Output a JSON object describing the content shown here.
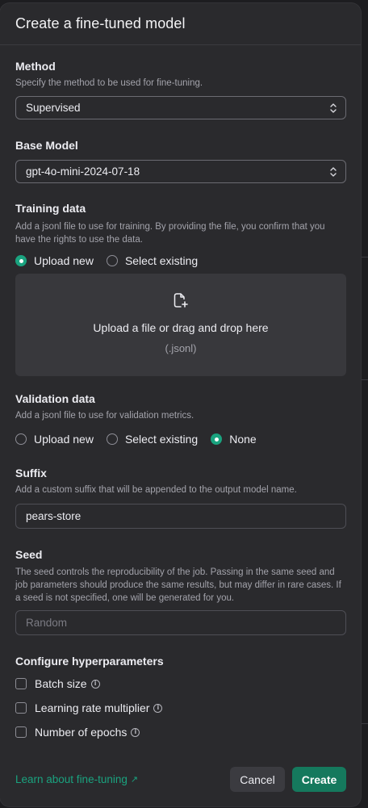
{
  "modal": {
    "title": "Create a fine-tuned model"
  },
  "method": {
    "label": "Method",
    "description": "Specify the method to be used for fine-tuning.",
    "selected": "Supervised"
  },
  "base_model": {
    "label": "Base Model",
    "selected": "gpt-4o-mini-2024-07-18"
  },
  "training_data": {
    "label": "Training data",
    "description": "Add a jsonl file to use for training. By providing the file, you confirm that you have the rights to use the data.",
    "options": [
      {
        "label": "Upload new",
        "selected": true
      },
      {
        "label": "Select existing",
        "selected": false
      }
    ],
    "dropzone_text": "Upload a file or drag and drop here",
    "dropzone_hint": "(.jsonl)"
  },
  "validation_data": {
    "label": "Validation data",
    "description": "Add a jsonl file to use for validation metrics.",
    "options": [
      {
        "label": "Upload new",
        "selected": false
      },
      {
        "label": "Select existing",
        "selected": false
      },
      {
        "label": "None",
        "selected": true
      }
    ]
  },
  "suffix": {
    "label": "Suffix",
    "description": "Add a custom suffix that will be appended to the output model name.",
    "value": "pears-store"
  },
  "seed": {
    "label": "Seed",
    "description": "The seed controls the reproducibility of the job. Passing in the same seed and job parameters should produce the same results, but may differ in rare cases. If a seed is not specified, one will be generated for you.",
    "placeholder": "Random"
  },
  "hyperparameters": {
    "label": "Configure hyperparameters",
    "items": [
      {
        "label": "Batch size",
        "checked": false
      },
      {
        "label": "Learning rate multiplier",
        "checked": false
      },
      {
        "label": "Number of epochs",
        "checked": false
      }
    ]
  },
  "footer": {
    "learn_link": "Learn about fine-tuning",
    "learn_icon": "external-link-arrow-icon",
    "cancel": "Cancel",
    "create": "Create"
  },
  "colors": {
    "accent": "#1aa37f",
    "create_button": "#15795d",
    "modal_bg": "#2a2a2d"
  }
}
